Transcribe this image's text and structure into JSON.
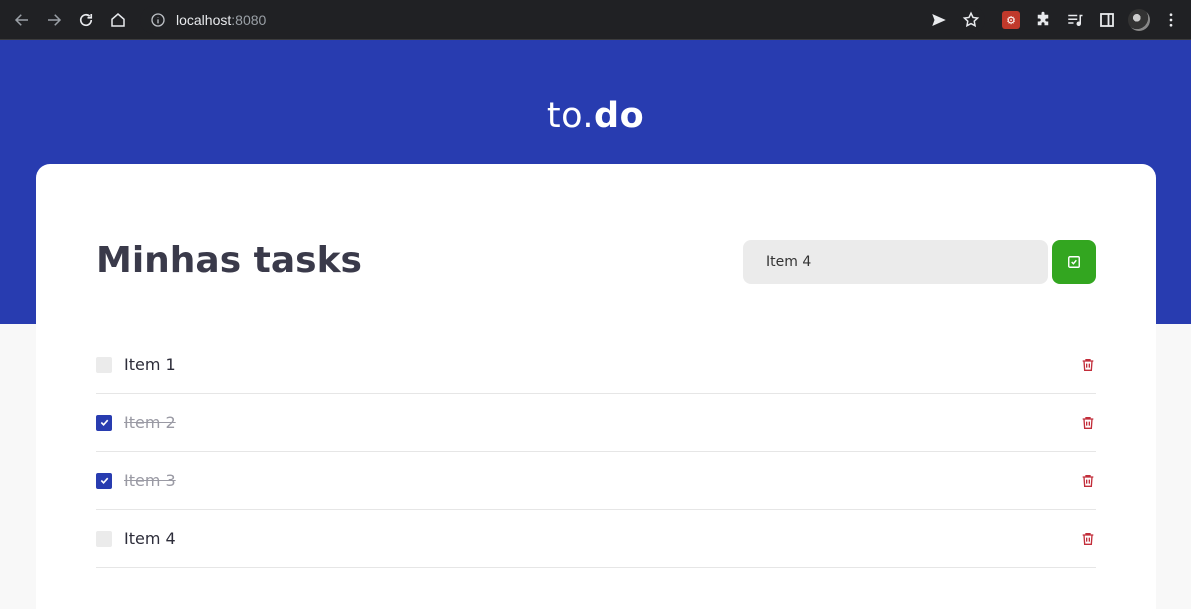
{
  "browser": {
    "url_host": "localhost",
    "url_port": ":8080"
  },
  "app": {
    "logo_light": "to.",
    "logo_bold": "do",
    "title": "Minhas tasks",
    "input_value": "Item 4",
    "accent_color": "#283cb0",
    "add_color": "#33a620",
    "delete_color": "#c22d3a"
  },
  "tasks": [
    {
      "label": "Item 1",
      "done": false
    },
    {
      "label": "Item 2",
      "done": true
    },
    {
      "label": "Item 3",
      "done": true
    },
    {
      "label": "Item 4",
      "done": false
    }
  ]
}
